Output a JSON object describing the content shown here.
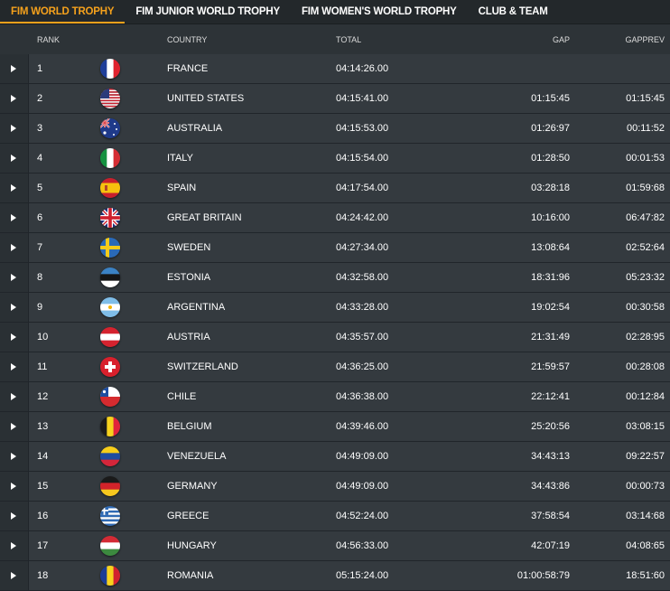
{
  "tabs": [
    {
      "label": "FIM WORLD TROPHY",
      "active": true
    },
    {
      "label": "FIM JUNIOR WORLD TROPHY",
      "active": false
    },
    {
      "label": "FIM WOMEN'S WORLD TROPHY",
      "active": false
    },
    {
      "label": "CLUB & TEAM",
      "active": false
    }
  ],
  "columns": {
    "rank": "RANK",
    "country": "COUNTRY",
    "total": "TOTAL",
    "gap": "GAP",
    "gapprev": "GAPPREV"
  },
  "colors": {
    "accent": "#f5a11c",
    "background": "#2d3337",
    "row": "#343a3f"
  },
  "rows": [
    {
      "rank": "1",
      "country": "FRANCE",
      "flag": "france-flag-icon",
      "total": "04:14:26.00",
      "gap": "",
      "gapprev": ""
    },
    {
      "rank": "2",
      "country": "UNITED STATES",
      "flag": "united-states-flag-icon",
      "total": "04:15:41.00",
      "gap": "01:15:45",
      "gapprev": "01:15:45"
    },
    {
      "rank": "3",
      "country": "AUSTRALIA",
      "flag": "australia-flag-icon",
      "total": "04:15:53.00",
      "gap": "01:26:97",
      "gapprev": "00:11:52"
    },
    {
      "rank": "4",
      "country": "ITALY",
      "flag": "italy-flag-icon",
      "total": "04:15:54.00",
      "gap": "01:28:50",
      "gapprev": "00:01:53"
    },
    {
      "rank": "5",
      "country": "SPAIN",
      "flag": "spain-flag-icon",
      "total": "04:17:54.00",
      "gap": "03:28:18",
      "gapprev": "01:59:68"
    },
    {
      "rank": "6",
      "country": "GREAT BRITAIN",
      "flag": "great-britain-flag-icon",
      "total": "04:24:42.00",
      "gap": "10:16:00",
      "gapprev": "06:47:82"
    },
    {
      "rank": "7",
      "country": "SWEDEN",
      "flag": "sweden-flag-icon",
      "total": "04:27:34.00",
      "gap": "13:08:64",
      "gapprev": "02:52:64"
    },
    {
      "rank": "8",
      "country": "ESTONIA",
      "flag": "estonia-flag-icon",
      "total": "04:32:58.00",
      "gap": "18:31:96",
      "gapprev": "05:23:32"
    },
    {
      "rank": "9",
      "country": "ARGENTINA",
      "flag": "argentina-flag-icon",
      "total": "04:33:28.00",
      "gap": "19:02:54",
      "gapprev": "00:30:58"
    },
    {
      "rank": "10",
      "country": "AUSTRIA",
      "flag": "austria-flag-icon",
      "total": "04:35:57.00",
      "gap": "21:31:49",
      "gapprev": "02:28:95"
    },
    {
      "rank": "11",
      "country": "SWITZERLAND",
      "flag": "switzerland-flag-icon",
      "total": "04:36:25.00",
      "gap": "21:59:57",
      "gapprev": "00:28:08"
    },
    {
      "rank": "12",
      "country": "CHILE",
      "flag": "chile-flag-icon",
      "total": "04:36:38.00",
      "gap": "22:12:41",
      "gapprev": "00:12:84"
    },
    {
      "rank": "13",
      "country": "BELGIUM",
      "flag": "belgium-flag-icon",
      "total": "04:39:46.00",
      "gap": "25:20:56",
      "gapprev": "03:08:15"
    },
    {
      "rank": "14",
      "country": "VENEZUELA",
      "flag": "venezuela-flag-icon",
      "total": "04:49:09.00",
      "gap": "34:43:13",
      "gapprev": "09:22:57"
    },
    {
      "rank": "15",
      "country": "GERMANY",
      "flag": "germany-flag-icon",
      "total": "04:49:09.00",
      "gap": "34:43:86",
      "gapprev": "00:00:73"
    },
    {
      "rank": "16",
      "country": "GREECE",
      "flag": "greece-flag-icon",
      "total": "04:52:24.00",
      "gap": "37:58:54",
      "gapprev": "03:14:68"
    },
    {
      "rank": "17",
      "country": "HUNGARY",
      "flag": "hungary-flag-icon",
      "total": "04:56:33.00",
      "gap": "42:07:19",
      "gapprev": "04:08:65"
    },
    {
      "rank": "18",
      "country": "ROMANIA",
      "flag": "romania-flag-icon",
      "total": "05:15:24.00",
      "gap": "01:00:58:79",
      "gapprev": "18:51:60"
    }
  ]
}
